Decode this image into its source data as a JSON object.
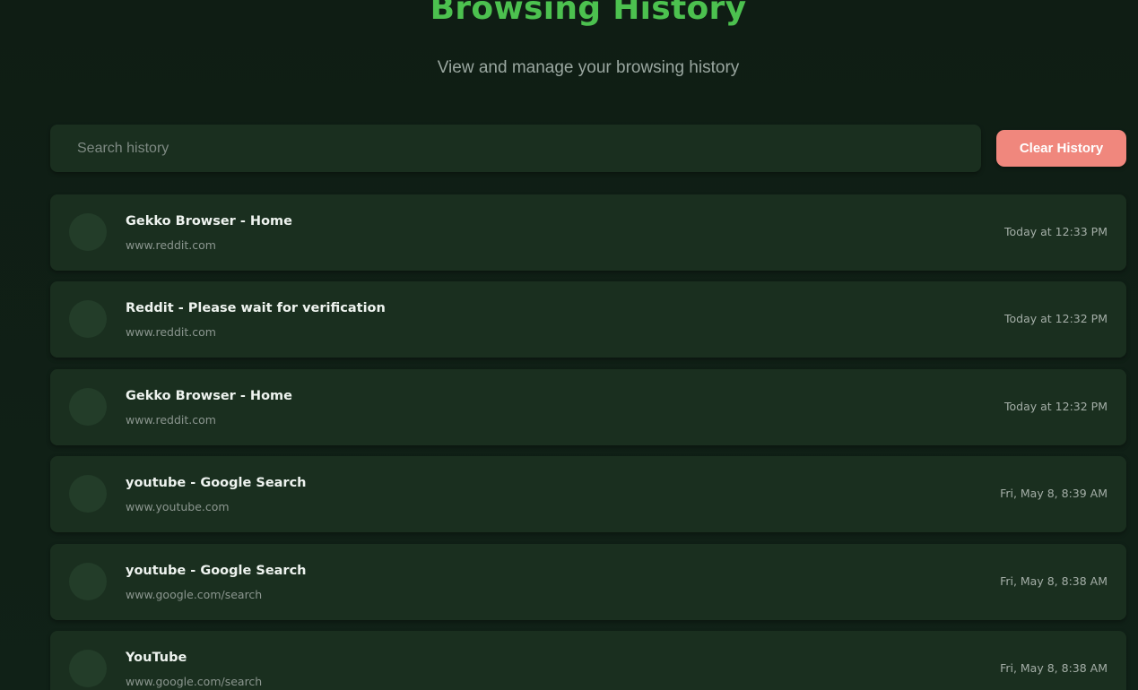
{
  "header": {
    "title": "Browsing History",
    "subtitle": "View and manage your browsing history"
  },
  "search": {
    "placeholder": "Search history",
    "value": ""
  },
  "actions": {
    "clear_label": "Clear History"
  },
  "colors": {
    "accent": "#4cc14f",
    "background": "#0f1d14",
    "card": "#1a2f1f",
    "clear_button": "#f0877d"
  },
  "history": [
    {
      "title": "Gekko Browser - Home",
      "url": "www.reddit.com",
      "time": "Today at 12:33 PM"
    },
    {
      "title": "Reddit - Please wait for verification",
      "url": "www.reddit.com",
      "time": "Today at 12:32 PM"
    },
    {
      "title": "Gekko Browser - Home",
      "url": "www.reddit.com",
      "time": "Today at 12:32 PM"
    },
    {
      "title": "youtube - Google Search",
      "url": "www.youtube.com",
      "time": "Fri, May 8, 8:39 AM"
    },
    {
      "title": "youtube - Google Search",
      "url": "www.google.com/search",
      "time": "Fri, May 8, 8:38 AM"
    },
    {
      "title": "YouTube",
      "url": "www.google.com/search",
      "time": "Fri, May 8, 8:38 AM"
    }
  ]
}
